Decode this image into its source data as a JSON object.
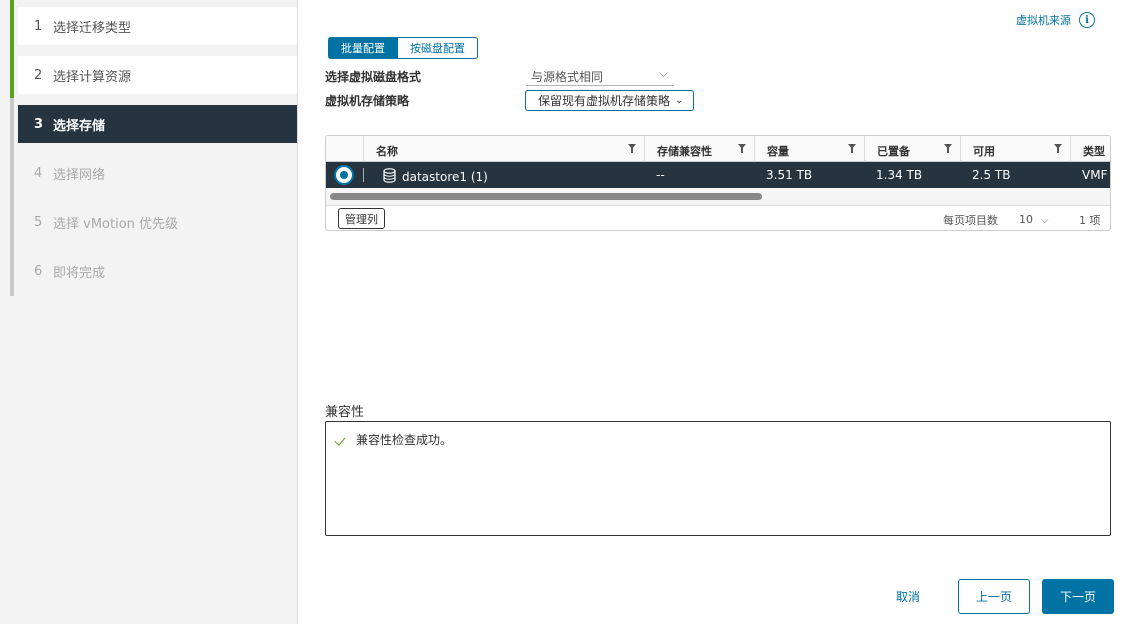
{
  "stepper": {
    "steps": [
      {
        "num": "1",
        "label": "选择迁移类型",
        "state": "done"
      },
      {
        "num": "2",
        "label": "选择计算资源",
        "state": "done"
      },
      {
        "num": "3",
        "label": "选择存储",
        "state": "active"
      },
      {
        "num": "4",
        "label": "选择网络",
        "state": "pending"
      },
      {
        "num": "5",
        "label": "选择 vMotion 优先级",
        "state": "pending"
      },
      {
        "num": "6",
        "label": "即将完成",
        "state": "pending"
      }
    ]
  },
  "header": {
    "vm_source_link": "虚拟机来源",
    "info_glyph": "i"
  },
  "config_toggle": {
    "batch_label": "批量配置",
    "per_disk_label": "按磁盘配置"
  },
  "form": {
    "disk_format_label": "选择虚拟磁盘格式",
    "disk_format_value": "与源格式相同",
    "storage_policy_label": "虚拟机存储策略",
    "storage_policy_value": "保留现有虚拟机存储策略"
  },
  "grid": {
    "columns": [
      "名称",
      "存储兼容性",
      "容量",
      "已置备",
      "可用",
      "类型"
    ],
    "rows": [
      {
        "name": "datastore1 (1)",
        "compatibility": "--",
        "capacity": "3.51 TB",
        "provisioned": "1.34 TB",
        "free": "2.5 TB",
        "type": "VMF"
      }
    ],
    "footer": {
      "manage_columns_label": "管理列",
      "per_page_label": "每页项目数",
      "page_size": "10",
      "item_count": "1 项"
    }
  },
  "compatibility": {
    "label": "兼容性",
    "message": "兼容性检查成功。"
  },
  "footer": {
    "cancel_label": "取消",
    "back_label": "上一页",
    "next_label": "下一页"
  },
  "colors": {
    "accent": "#0072a3",
    "active_step_bg": "#25343f",
    "done_bar": "#5aa220",
    "success": "#5aa220"
  }
}
